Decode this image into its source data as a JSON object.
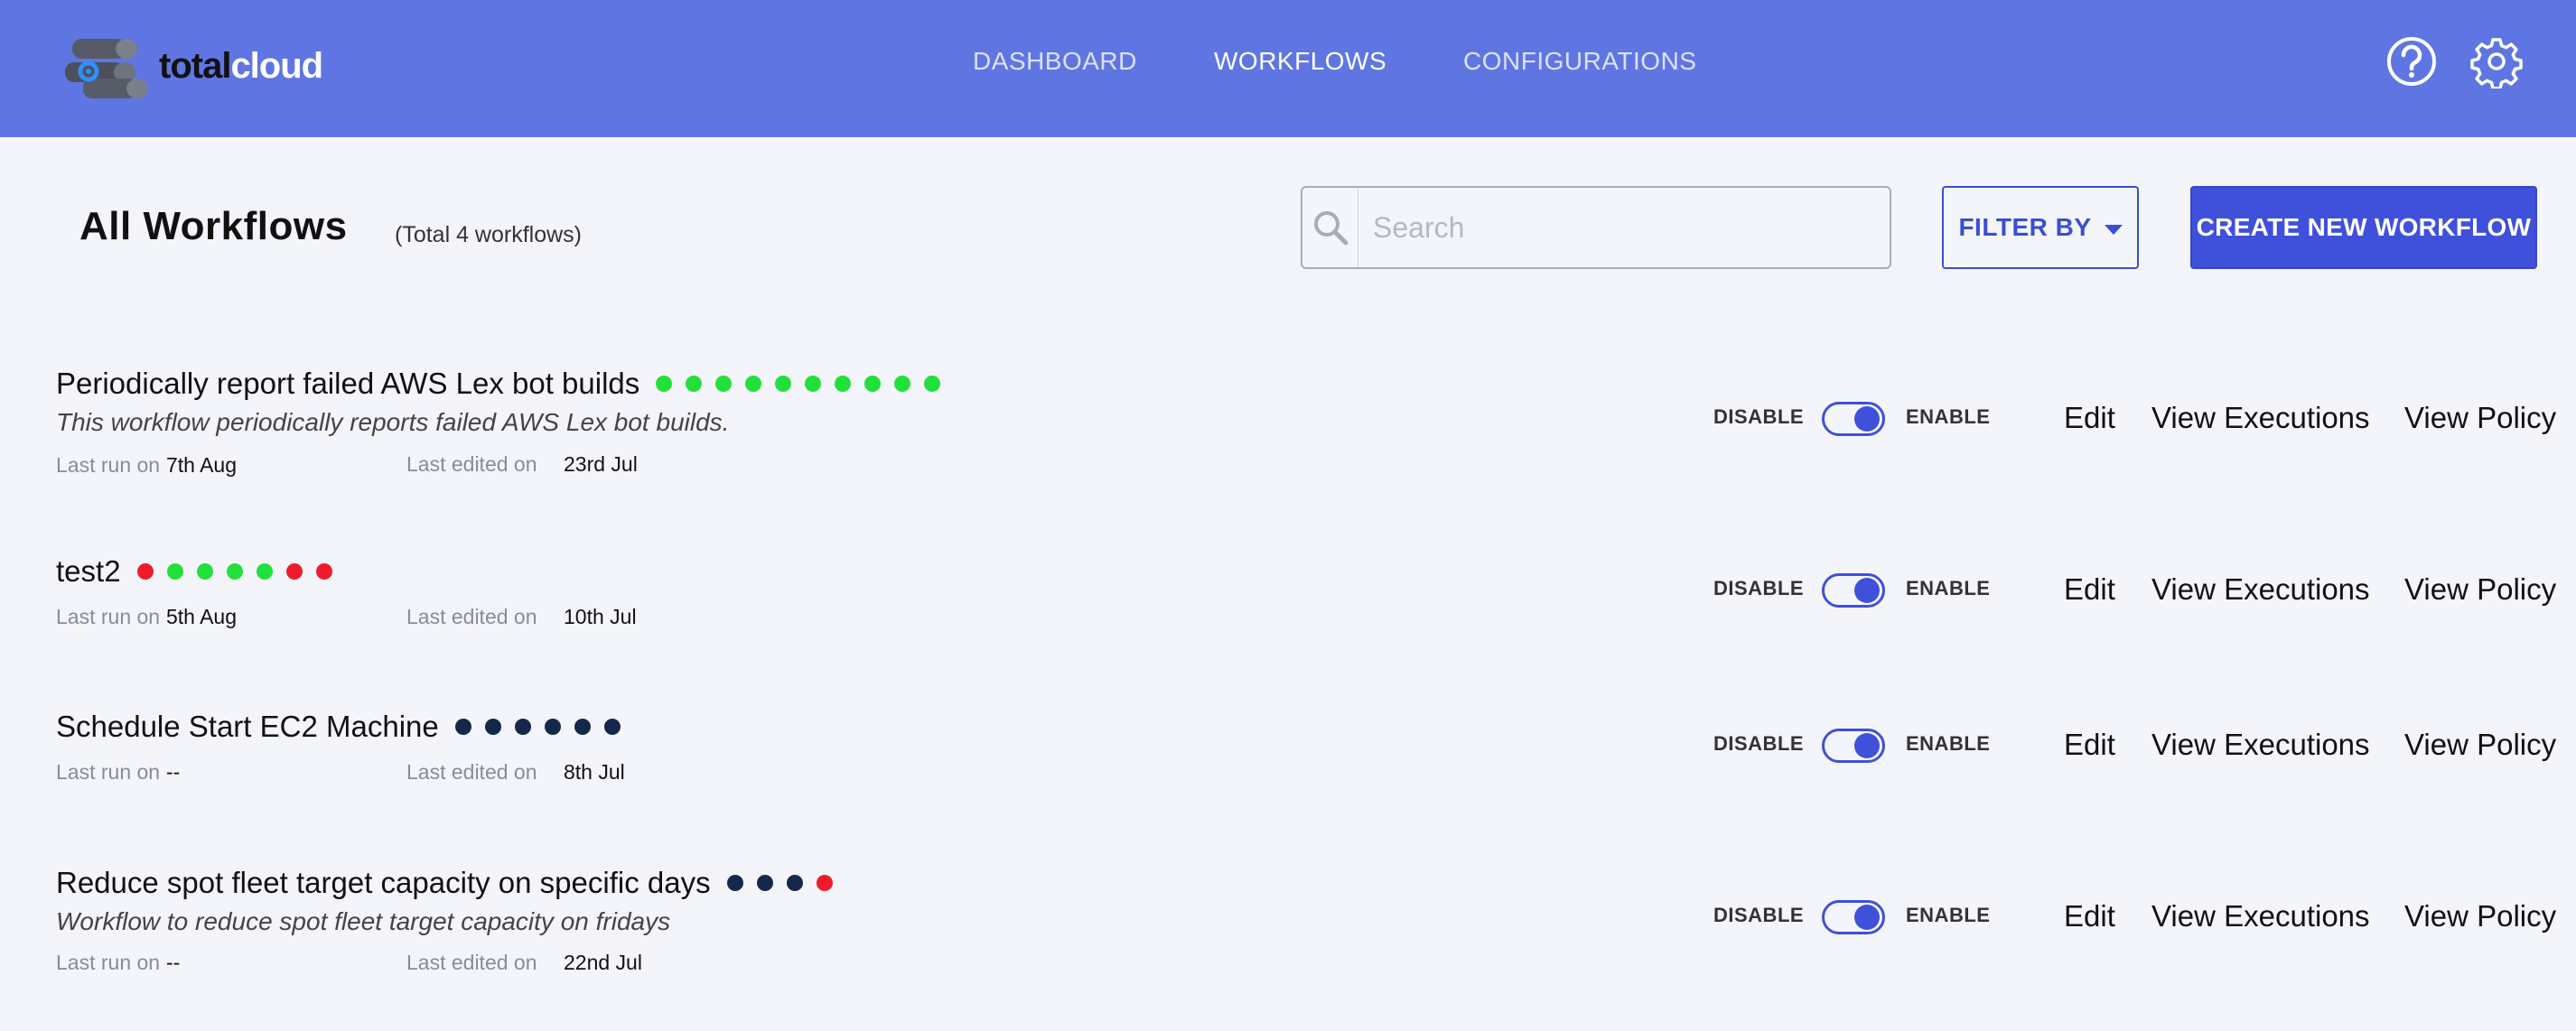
{
  "app": {
    "logo_text_a": "total",
    "logo_text_b": "cloud",
    "nav": [
      {
        "label": "DASHBOARD"
      },
      {
        "label": "WORKFLOWS"
      },
      {
        "label": "CONFIGURATIONS"
      }
    ],
    "active_nav": "WORKFLOWS"
  },
  "page": {
    "title": "All Workflows",
    "count_text": "(Total 4 workflows)",
    "search_placeholder": "Search",
    "filter_label": "FILTER BY",
    "create_label": "CREATE NEW WORKFLOW"
  },
  "labels": {
    "last_run": "Last run on",
    "last_edited": "Last edited on",
    "disable": "DISABLE",
    "enable": "ENABLE",
    "edit": "Edit",
    "view_executions": "View Executions",
    "view_policy": "View Policy"
  },
  "colors": {
    "header": "#5f76e2",
    "accent": "#3f50db",
    "success": "#22e03a",
    "failure": "#ee1c2b",
    "pending": "#15284b"
  },
  "workflows": [
    {
      "name": "Periodically report failed AWS Lex bot builds",
      "description": "This workflow periodically reports failed AWS Lex bot builds.",
      "last_run": "7th Aug",
      "last_edited": "23rd Jul",
      "enabled": true,
      "runs": [
        "success",
        "success",
        "success",
        "success",
        "success",
        "success",
        "success",
        "success",
        "success",
        "success"
      ]
    },
    {
      "name": "test2",
      "description": "",
      "last_run": "5th Aug",
      "last_edited": "10th Jul",
      "enabled": true,
      "runs": [
        "failure",
        "success",
        "success",
        "success",
        "success",
        "failure",
        "failure"
      ]
    },
    {
      "name": "Schedule Start EC2 Machine",
      "description": "",
      "last_run": "--",
      "last_edited": "8th Jul",
      "enabled": true,
      "runs": [
        "pending",
        "pending",
        "pending",
        "pending",
        "pending",
        "pending"
      ]
    },
    {
      "name": "Reduce spot fleet target capacity on specific days",
      "description": "Workflow to reduce spot fleet target capacity on fridays",
      "last_run": "--",
      "last_edited": "22nd Jul",
      "enabled": true,
      "runs": [
        "pending",
        "pending",
        "pending",
        "failure"
      ]
    }
  ]
}
